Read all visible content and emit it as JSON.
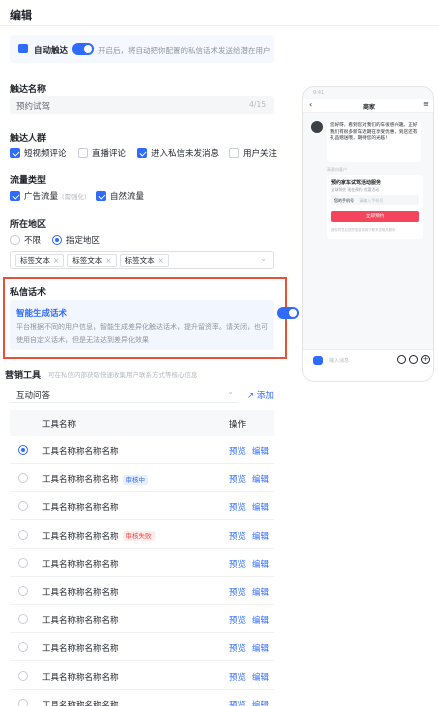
{
  "header": {
    "title": "编辑"
  },
  "auto_reach": {
    "label": "自动触达",
    "desc": "开启后，将自动把你配置的私信话术发送给潜在用户",
    "enabled": true
  },
  "reach_name": {
    "label": "触达名称",
    "value": "预约试驾",
    "counter": "4/15"
  },
  "reach_crowd": {
    "label": "触达人群",
    "options": [
      {
        "label": "短视频评论",
        "checked": true
      },
      {
        "label": "直播评论",
        "checked": false
      },
      {
        "label": "进入私信未发消息",
        "checked": true
      },
      {
        "label": "用户关注",
        "checked": false
      }
    ]
  },
  "traffic": {
    "label": "流量类型",
    "options": [
      {
        "label": "广告流量",
        "note": "(需强化)",
        "checked": true
      },
      {
        "label": "自然流量",
        "note": "",
        "checked": true
      }
    ]
  },
  "region": {
    "label": "所在地区",
    "options": [
      {
        "label": "不限",
        "selected": false
      },
      {
        "label": "指定地区",
        "selected": true
      }
    ],
    "tags": [
      "标签文本",
      "标签文本",
      "标签文本"
    ]
  },
  "pm": {
    "label": "私信话术",
    "card_title": "智能生成话术",
    "enabled": true,
    "card_desc_line1": "平台根据不同的用户信息，智能生成差异化触达话术，提升留资率。请关闭，也可",
    "card_desc_line2": "使用自定义话术，但是无法达到差异化效果"
  },
  "marketing": {
    "label": "营销工具",
    "desc": "可在私信内部获取快速收集用户联系方式等核心信息",
    "enabled": true,
    "select_value": "互动问答",
    "add_label": "添加",
    "col_name": "工具名称",
    "col_ops": "操作",
    "rows": [
      {
        "name": "工具名称称名称名称",
        "badge": "",
        "selected": true
      },
      {
        "name": "工具名称称名称名称",
        "badge": "审核中",
        "badge_type": "rev",
        "selected": false
      },
      {
        "name": "工具名称称名称名称",
        "badge": "",
        "selected": false
      },
      {
        "name": "工具名称称名称名称",
        "badge": "审核失败",
        "badge_type": "fail",
        "selected": false
      },
      {
        "name": "工具名称称名称名称",
        "badge": "",
        "selected": false
      },
      {
        "name": "工具名称称名称名称",
        "badge": "",
        "selected": false
      },
      {
        "name": "工具名称称名称名称",
        "badge": "",
        "selected": false
      },
      {
        "name": "工具名称称名称名称",
        "badge": "",
        "selected": false
      },
      {
        "name": "工具名称称名称名称",
        "badge": "",
        "selected": false
      },
      {
        "name": "工具名称称名称名称",
        "badge": "",
        "selected": false
      }
    ],
    "op_preview": "预览",
    "op_edit": "编辑"
  },
  "preview": {
    "status_time": "9:41",
    "chat_title": "商家",
    "msg": "您好呀，看到您对我们的车很感兴趣。正好我们有很多新车近期在享受优惠，到店还有礼品赠送哦，期待您的光临！",
    "card_hint": "高意向客户",
    "card_title": "预约家车试驾活动服务",
    "card_sub": [
      "全球领先",
      "现在预约",
      "优惠活动"
    ],
    "form_label": "您的手机号",
    "form_placeholder": "请输入手机号",
    "cta": "立即预约",
    "agree": "授权同意后您的信息将用于联系您相关服务",
    "input_placeholder": "输入消息"
  },
  "colors": {
    "accent": "#2f6bff",
    "danger": "#f54a45",
    "highlight_border": "#e8503a"
  }
}
